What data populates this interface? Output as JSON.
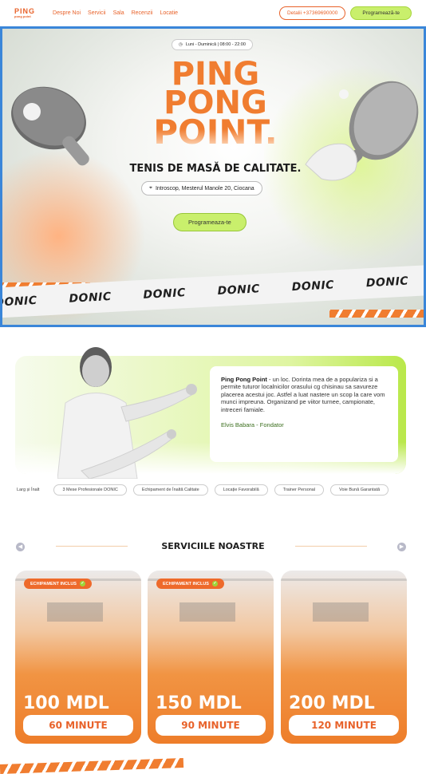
{
  "nav": {
    "logo_top": "PING",
    "logo_bottom": "pong point",
    "links": [
      "Despre Noi",
      "Servicii",
      "Sala",
      "Recenzii",
      "Locatie"
    ],
    "phone_label": "Detalii +37369690000",
    "book_label": "Programează-te"
  },
  "hero": {
    "hours": "Luni - Duminică | 08:00 - 22:00",
    "title_1": "PING",
    "title_2": "PONG",
    "title_3": "POINT.",
    "subtitle": "TENIS DE MASĂ DE CALITATE.",
    "address": "Introscop, Mesterul Manole 20, Ciocana",
    "cta": "Programeaza-te",
    "brand": "DONIC"
  },
  "founder": {
    "name": "Ping Pong Point",
    "text": " - un loc. Dorinta mea de a populariza si a permite tuturor localnicilor orasului cg chisinau sa savureze placerea acestui joc. Astfel a luat nastere un scop la care vom munci impreuna. Organizand pe viitor turnee, campionate, intreceri famiale.",
    "signature": "Elvis Babara - Fondator"
  },
  "chips": [
    "Larg și Înalt",
    "3 Mese Profesionale DONIC",
    "Echipament de Înaltă Calitate",
    "Locație Favorabilă",
    "Trainer Personal",
    "Voie Bună Garantată"
  ],
  "services": {
    "title": "SERVICIILE NOASTRE",
    "badge": "ECHIPAMENT INCLUS",
    "cards": [
      {
        "price": "100 MDL",
        "minutes": "60 MINUTE"
      },
      {
        "price": "150 MDL",
        "minutes": "90 MINUTE"
      },
      {
        "price": "200 MDL",
        "minutes": "120 MINUTE"
      }
    ]
  },
  "colors": {
    "accent": "#f07d30",
    "lime": "#c9ef6c",
    "frame": "#3a86d9"
  }
}
